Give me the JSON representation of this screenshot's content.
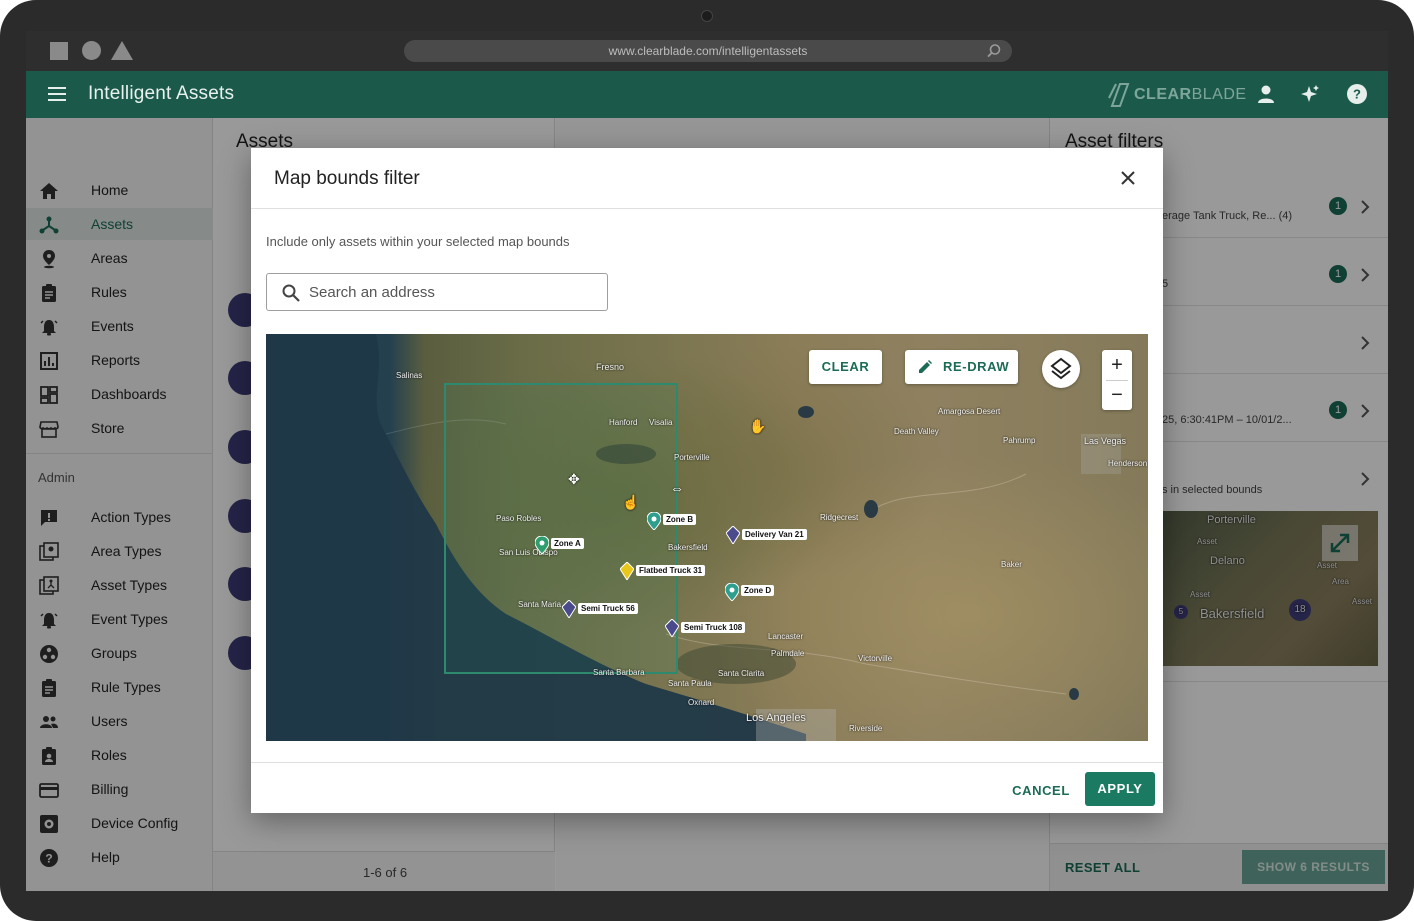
{
  "browser": {
    "url": "www.clearblade.com/intelligentassets"
  },
  "app": {
    "title": "Intelligent Assets",
    "logo_bold": "CLEAR",
    "logo_thin": "BLADE",
    "accent": "#1b5a4a"
  },
  "sidebar": {
    "items": [
      {
        "label": "Home",
        "icon": "home-icon"
      },
      {
        "label": "Assets",
        "icon": "assets-icon",
        "active": true
      },
      {
        "label": "Areas",
        "icon": "location-pin-icon"
      },
      {
        "label": "Rules",
        "icon": "clipboard-icon"
      },
      {
        "label": "Events",
        "icon": "alarm-icon"
      },
      {
        "label": "Reports",
        "icon": "bar-chart-icon"
      },
      {
        "label": "Dashboards",
        "icon": "dashboard-icon"
      },
      {
        "label": "Store",
        "icon": "store-icon"
      }
    ],
    "admin_label": "Admin",
    "admin_items": [
      {
        "label": "Action Types",
        "icon": "alert-message-icon"
      },
      {
        "label": "Area Types",
        "icon": "area-types-icon"
      },
      {
        "label": "Asset Types",
        "icon": "asset-types-icon"
      },
      {
        "label": "Event Types",
        "icon": "alarm-icon"
      },
      {
        "label": "Groups",
        "icon": "groups-icon"
      },
      {
        "label": "Rule Types",
        "icon": "clipboard-icon"
      },
      {
        "label": "Users",
        "icon": "users-icon"
      },
      {
        "label": "Roles",
        "icon": "badge-icon"
      },
      {
        "label": "Billing",
        "icon": "credit-card-icon"
      },
      {
        "label": "Device Config",
        "icon": "gear-icon"
      },
      {
        "label": "Help",
        "icon": "help-icon"
      }
    ]
  },
  "assets_panel": {
    "title": "Assets",
    "pager": "1-6 of 6"
  },
  "filters_panel": {
    "title": "Asset filters",
    "rows": [
      {
        "text": "erage Tank Truck, Re...  (4)",
        "badge": "1"
      },
      {
        "text": "5",
        "badge": "1"
      },
      {
        "text": "",
        "badge": ""
      },
      {
        "text": "25, 6:30:41PM – 10/01/2...",
        "badge": "1"
      },
      {
        "text": "s in selected bounds",
        "badge": ""
      }
    ],
    "reset_all": "RESET ALL",
    "show_results": "SHOW 6 RESULTS"
  },
  "modal": {
    "title": "Map bounds filter",
    "description": "Include only assets within your selected map bounds",
    "search_placeholder": "Search an address",
    "clear_label": "CLEAR",
    "redraw_label": "RE-DRAW",
    "zoom_in": "+",
    "zoom_out": "−",
    "cancel_label": "CANCEL",
    "apply_label": "APPLY"
  },
  "map": {
    "places": [
      "Fresno",
      "Salinas",
      "Hanford",
      "Visalia",
      "Porterville",
      "Bakersfield",
      "Santa Maria",
      "Santa Barbara",
      "Los Angeles",
      "Riverside",
      "Las Vegas",
      "Death Valley",
      "Oxnard",
      "Lancaster",
      "Palmdale",
      "Santa Clarita",
      "Victorville",
      "Ridgecrest",
      "Paso Robles",
      "San Luis Obispo",
      "Amargosa Desert",
      "Pahrump",
      "Henderson",
      "Santa Paula",
      "Baker"
    ],
    "markers": [
      {
        "label": "Zone A",
        "color": "#2e9e6e"
      },
      {
        "label": "Zone B",
        "color": "#2e9e8e"
      },
      {
        "label": "Zone D",
        "color": "#2e9e8e"
      },
      {
        "label": "Delivery Van 21",
        "color": "#4a4a8c"
      },
      {
        "label": "Flatbed Truck 31",
        "color": "#e8c61a"
      },
      {
        "label": "Semi Truck 56",
        "color": "#4a4a8c"
      },
      {
        "label": "Semi Truck 108",
        "color": "#4a4a8c"
      }
    ]
  },
  "mini_map": {
    "places": [
      "Porterville",
      "Delano",
      "Bakersfield"
    ],
    "labels": [
      "Asset",
      "Asset",
      "Asset",
      "Area",
      "Asset"
    ],
    "cluster_a": "5",
    "cluster_b": "18"
  }
}
